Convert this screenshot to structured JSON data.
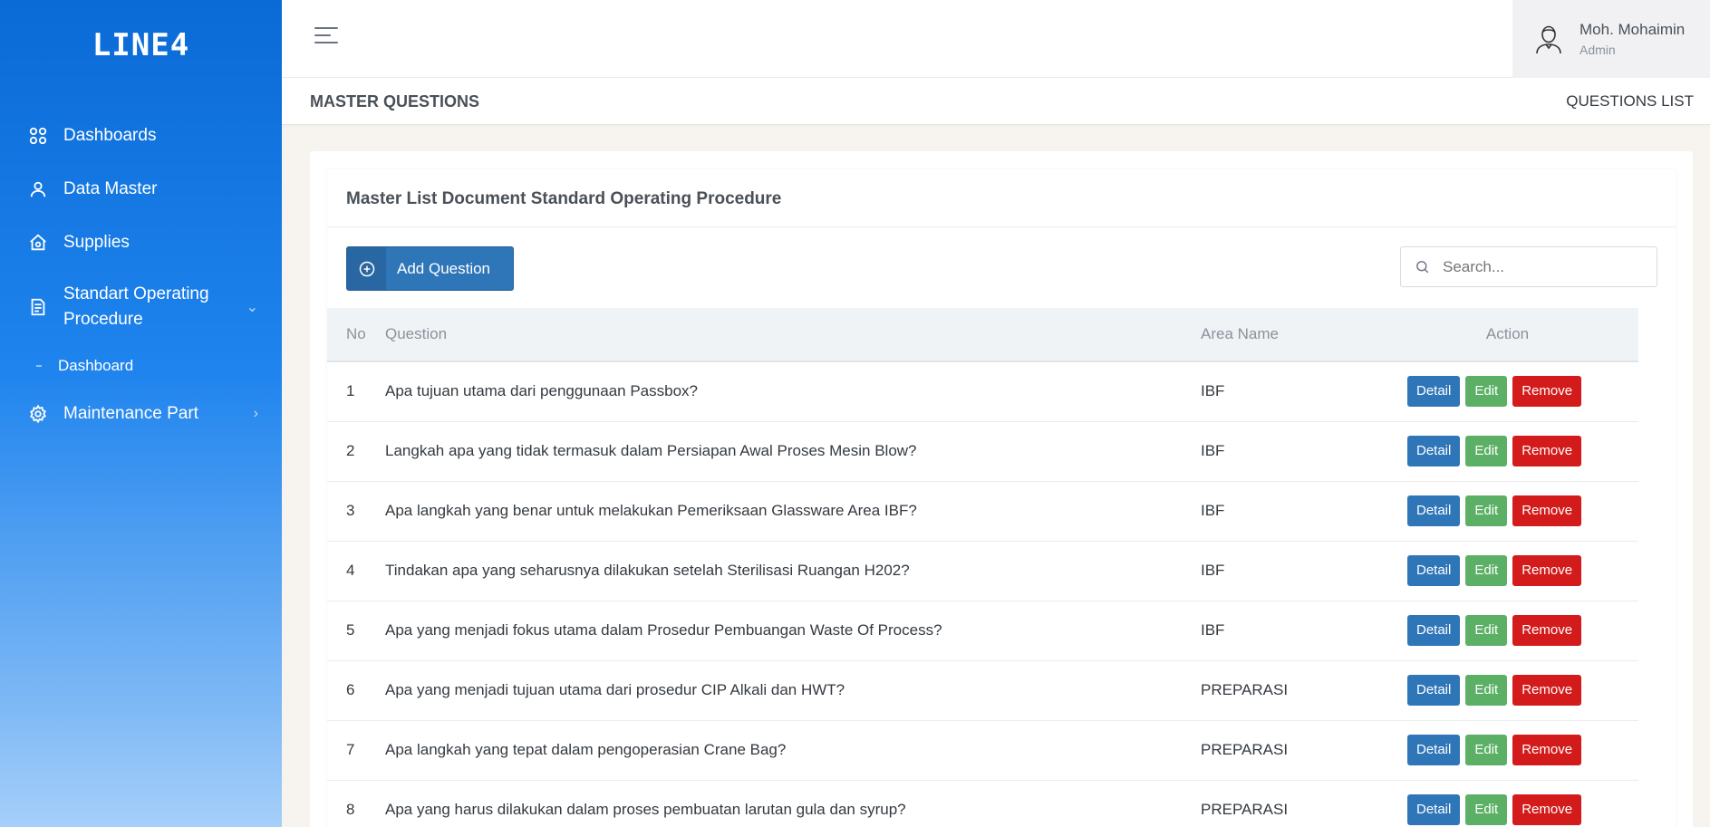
{
  "app": {
    "logo_text": "LINE4"
  },
  "sidebar": {
    "items": [
      {
        "label": "Dashboards",
        "icon": "grid-icon"
      },
      {
        "label": "Data Master",
        "icon": "user-icon"
      },
      {
        "label": "Supplies",
        "icon": "store-icon"
      },
      {
        "label": "Standart Operating Procedure",
        "icon": "document-icon",
        "expanded": true,
        "children": [
          {
            "label": "Dashboard"
          }
        ]
      },
      {
        "label": "Maintenance Part",
        "icon": "gear-icon"
      }
    ]
  },
  "header": {
    "user_name": "Moh. Mohaimin",
    "user_role": "Admin"
  },
  "page": {
    "title": "MASTER QUESTIONS",
    "breadcrumb": "QUESTIONS LIST"
  },
  "card": {
    "title": "Master List Document Standard Operating Procedure",
    "add_button": "Add Question",
    "search_placeholder": "Search..."
  },
  "table": {
    "columns": {
      "no": "No",
      "question": "Question",
      "area": "Area Name",
      "action": "Action"
    },
    "actions": {
      "detail": "Detail",
      "edit": "Edit",
      "remove": "Remove"
    },
    "rows": [
      {
        "no": "1",
        "question": "Apa tujuan utama dari penggunaan Passbox?",
        "area": "IBF"
      },
      {
        "no": "2",
        "question": "Langkah apa yang tidak termasuk dalam Persiapan Awal Proses Mesin Blow?",
        "area": "IBF"
      },
      {
        "no": "3",
        "question": "Apa langkah yang benar untuk melakukan Pemeriksaan Glassware Area IBF?",
        "area": "IBF"
      },
      {
        "no": "4",
        "question": "Tindakan apa yang seharusnya dilakukan setelah Sterilisasi Ruangan H202?",
        "area": "IBF"
      },
      {
        "no": "5",
        "question": "Apa yang menjadi fokus utama dalam Prosedur Pembuangan Waste Of Process?",
        "area": "IBF"
      },
      {
        "no": "6",
        "question": "Apa yang menjadi tujuan utama dari prosedur CIP Alkali dan HWT?",
        "area": "PREPARASI"
      },
      {
        "no": "7",
        "question": "Apa langkah yang tepat dalam pengoperasian Crane Bag?",
        "area": "PREPARASI"
      },
      {
        "no": "8",
        "question": "Apa yang harus dilakukan dalam proses pembuatan larutan gula dan syrup?",
        "area": "PREPARASI"
      }
    ]
  }
}
